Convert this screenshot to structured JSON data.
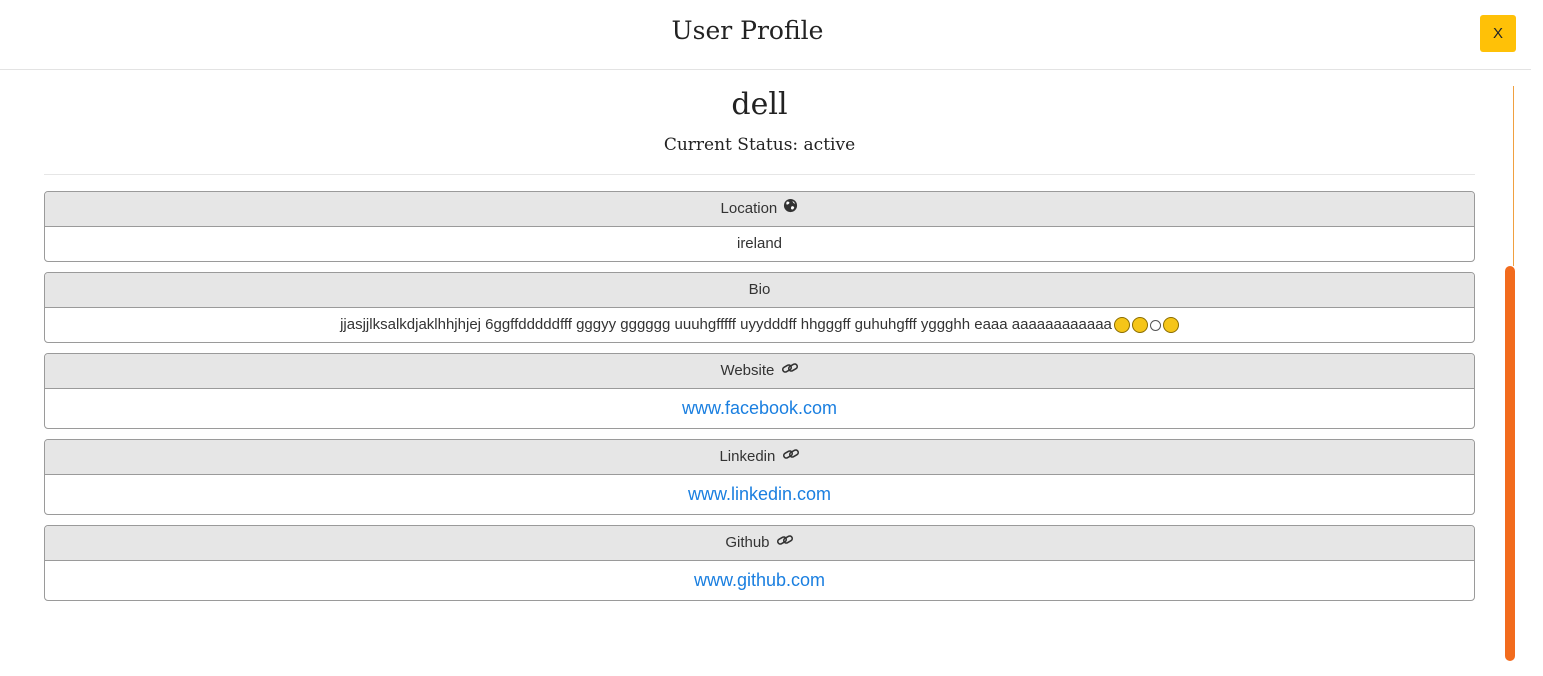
{
  "modal": {
    "title": "User Profile",
    "close_label": "X"
  },
  "profile": {
    "username": "dell",
    "status_text": "Current Status: active"
  },
  "sections": {
    "location": {
      "label": "Location",
      "icon": "globe-icon",
      "value": "ireland"
    },
    "bio": {
      "label": "Bio",
      "value": "jjasjjlksalkdjaklhhjhjej 6ggffdddddfff gggyy gggggg uuuhgfffff uyydddff hhgggff guhuhgfff yggghh eaaa aaaaaaaaaaaa",
      "emojis": [
        "grinning-smiling-eyes-emoji",
        "grinning-emoji",
        "smiling-face-emoji",
        "smiling-halo-emoji"
      ]
    },
    "website": {
      "label": "Website",
      "icon": "link-icon",
      "value": "www.facebook.com"
    },
    "linkedin": {
      "label": "Linkedin",
      "icon": "link-icon",
      "value": "www.linkedin.com"
    },
    "github": {
      "label": "Github",
      "icon": "link-icon",
      "value": "www.github.com"
    }
  },
  "colors": {
    "close_button": "#ffc107",
    "link": "#1a7fe0",
    "scrollbar_thumb": "#f26b1d",
    "card_header_bg": "#e6e6e6"
  }
}
